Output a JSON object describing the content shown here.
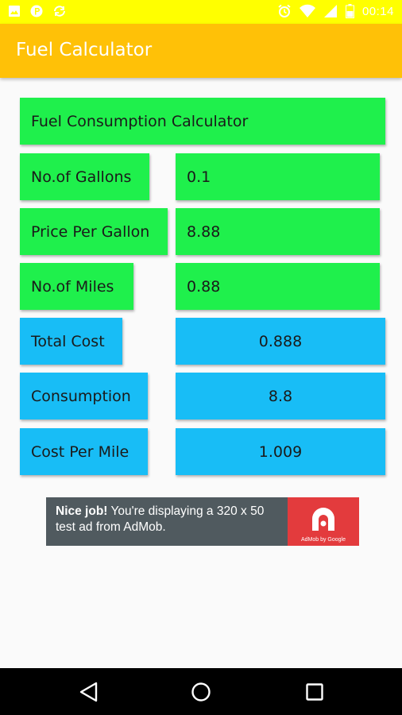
{
  "status_bar": {
    "time": "00:14"
  },
  "app_bar": {
    "title": "Fuel Calculator"
  },
  "calculator": {
    "header": "Fuel Consumption Calculator",
    "gallons": {
      "label": "No.of Gallons",
      "value": "0.1"
    },
    "price": {
      "label": "Price Per Gallon",
      "value": "8.88"
    },
    "miles": {
      "label": "No.of Miles",
      "value": "0.88"
    },
    "total_cost": {
      "label": "Total Cost",
      "value": "0.888"
    },
    "consumption": {
      "label": "Consumption",
      "value": "8.8"
    },
    "cost_per_mile": {
      "label": "Cost Per Mile",
      "value": "1.009"
    }
  },
  "ad": {
    "bold": "Nice job!",
    "text": " You're displaying a 320 x 50 test ad from AdMob.",
    "logo_caption": "AdMob by Google"
  },
  "colors": {
    "status_bar": "#ffff00",
    "app_bar": "#ffc107",
    "input_green": "#1ff04c",
    "result_blue": "#18bdf6",
    "ad_bg": "#505a5f",
    "ad_logo": "#e33b3d"
  },
  "icons": [
    "image-icon",
    "p-icon",
    "sync-icon",
    "alarm-icon",
    "wifi-icon",
    "signal-icon",
    "battery-icon",
    "back-icon",
    "home-icon",
    "recents-icon"
  ]
}
